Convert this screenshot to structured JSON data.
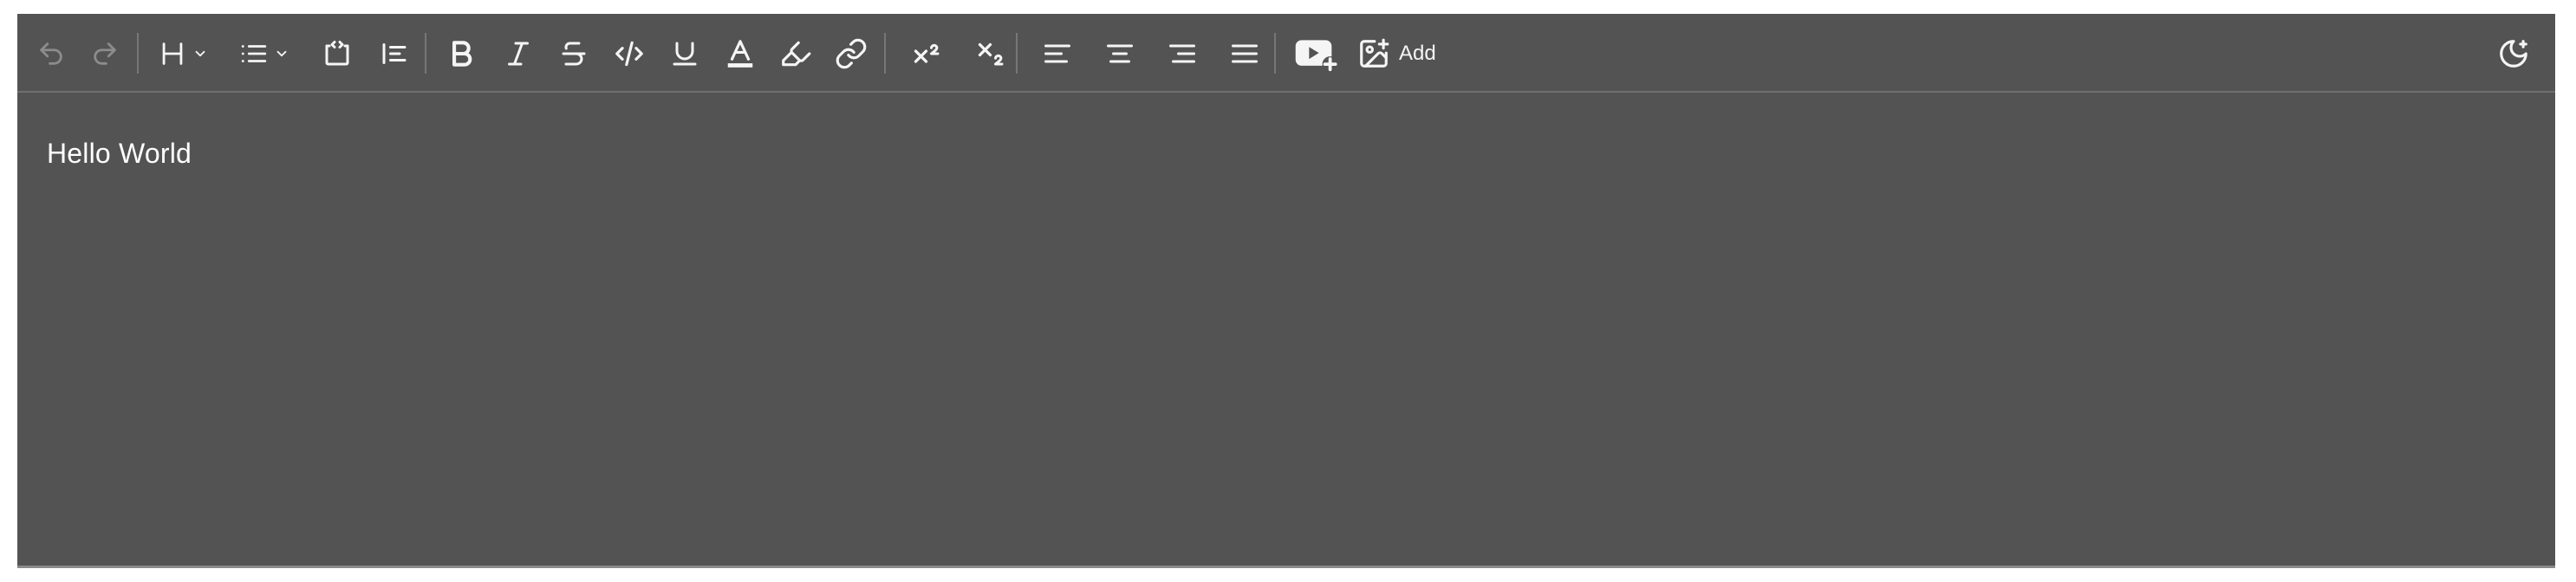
{
  "toolbar": {
    "history": [
      {
        "name": "undo-icon",
        "state": "disabled"
      },
      {
        "name": "redo-icon",
        "state": "disabled"
      }
    ],
    "block_group": [
      {
        "name": "heading-dropdown",
        "icon": "heading-icon"
      },
      {
        "name": "list-dropdown",
        "icon": "list-icon"
      },
      {
        "name": "code-block-button",
        "icon": "code-block-icon"
      },
      {
        "name": "blockquote-button",
        "icon": "blockquote-icon"
      }
    ],
    "mark_group": [
      {
        "name": "bold-button",
        "icon": "bold-icon"
      },
      {
        "name": "italic-button",
        "icon": "italic-icon"
      },
      {
        "name": "strike-button",
        "icon": "strikethrough-icon"
      },
      {
        "name": "code-button",
        "icon": "code-icon"
      },
      {
        "name": "underline-button",
        "icon": "underline-icon"
      },
      {
        "name": "text-color-button",
        "icon": "text-color-icon"
      },
      {
        "name": "highlight-button",
        "icon": "highlighter-icon"
      },
      {
        "name": "link-button",
        "icon": "link-icon"
      }
    ],
    "script_group": [
      {
        "name": "superscript-button",
        "icon": "superscript-icon"
      },
      {
        "name": "subscript-button",
        "icon": "subscript-icon"
      }
    ],
    "align_group": [
      {
        "name": "align-left-button",
        "icon": "align-left-icon"
      },
      {
        "name": "align-center-button",
        "icon": "align-center-icon"
      },
      {
        "name": "align-right-button",
        "icon": "align-right-icon"
      },
      {
        "name": "align-justify-button",
        "icon": "align-justify-icon"
      }
    ],
    "media_group": [
      {
        "name": "add-video-button",
        "icon": "video-plus-icon"
      },
      {
        "name": "add-image-button",
        "icon": "image-plus-icon"
      }
    ],
    "add_label": "Add",
    "theme_toggle": {
      "name": "theme-toggle-button",
      "icon": "moon-icon"
    }
  },
  "editor": {
    "content": "Hello World"
  },
  "colors": {
    "background": "#535353",
    "icon": "#f5f5f5",
    "icon_disabled": "#8c8c8c",
    "separator": "#777777",
    "text": "#ffffff"
  }
}
